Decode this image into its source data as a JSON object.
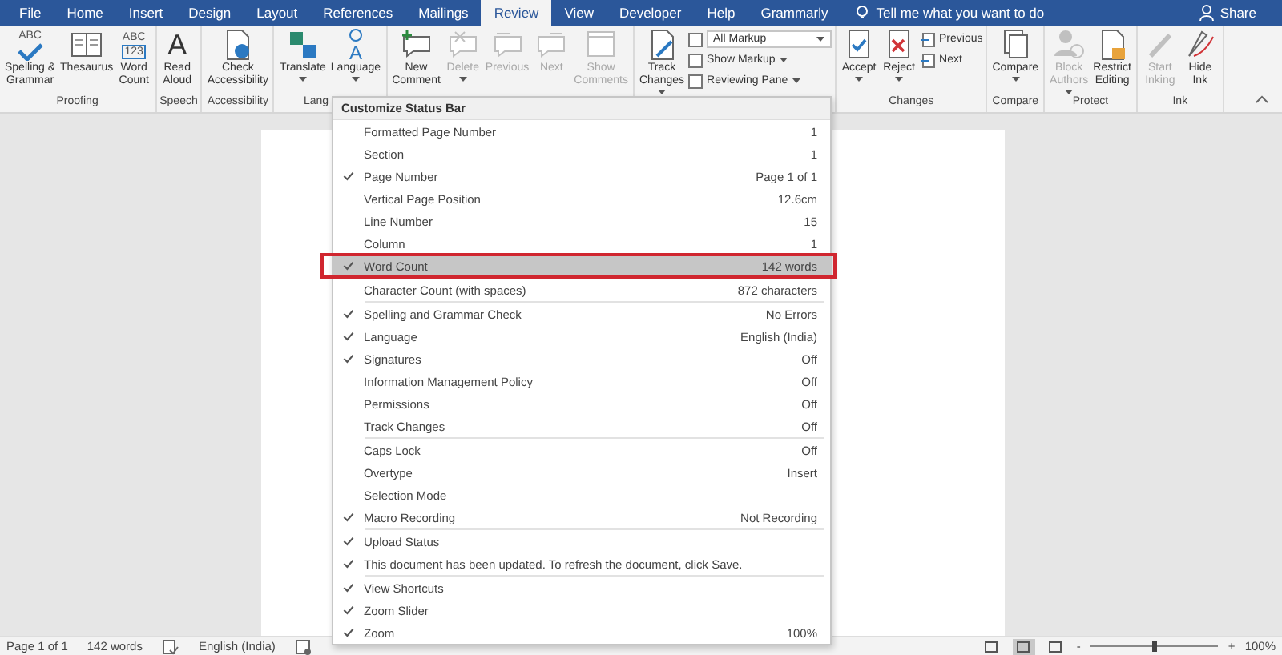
{
  "tabs": [
    {
      "label": "File",
      "selected": false
    },
    {
      "label": "Home",
      "selected": false
    },
    {
      "label": "Insert",
      "selected": false
    },
    {
      "label": "Design",
      "selected": false
    },
    {
      "label": "Layout",
      "selected": false
    },
    {
      "label": "References",
      "selected": false
    },
    {
      "label": "Mailings",
      "selected": false
    },
    {
      "label": "Review",
      "selected": true
    },
    {
      "label": "View",
      "selected": false
    },
    {
      "label": "Developer",
      "selected": false
    },
    {
      "label": "Help",
      "selected": false
    },
    {
      "label": "Grammarly",
      "selected": false
    }
  ],
  "tell_me": {
    "placeholder": "Tell me what you want to do"
  },
  "share": {
    "label": "Share"
  },
  "ribbon": {
    "groups": [
      {
        "label": "Proofing",
        "buttons": [
          {
            "label": "Spelling &\nGrammar",
            "badge": "ABC",
            "disabled": false,
            "dropdown": false
          },
          {
            "label": "Thesaurus",
            "disabled": false,
            "dropdown": false
          },
          {
            "label": "Word\nCount",
            "badge": "ABC",
            "badge_2": "123",
            "disabled": false,
            "dropdown": false
          }
        ]
      },
      {
        "label": "Speech",
        "buttons": [
          {
            "label": "Read\nAloud",
            "badge": "A",
            "disabled": false,
            "dropdown": false
          }
        ]
      },
      {
        "label": "Accessibility",
        "buttons": [
          {
            "label": "Check\nAccessibility",
            "disabled": false,
            "dropdown": false
          }
        ]
      },
      {
        "label": "Lang",
        "buttons": [
          {
            "label": "Translate",
            "disabled": false,
            "dropdown": true
          },
          {
            "label": "Language",
            "badge": "A",
            "disabled": false,
            "dropdown": true
          }
        ]
      },
      {
        "buttons": [
          {
            "label": "New\nComment",
            "disabled": false,
            "dropdown": false
          },
          {
            "label": "Delete",
            "disabled": true,
            "dropdown": true
          },
          {
            "label": "Previous",
            "disabled": true,
            "dropdown": false
          },
          {
            "label": "Next",
            "disabled": true,
            "dropdown": false
          },
          {
            "label": "Show\nComments",
            "disabled": true,
            "dropdown": false
          }
        ]
      },
      {
        "buttons": [
          {
            "label": "Track\nChanges",
            "disabled": false,
            "dropdown": true
          }
        ],
        "small_items": [
          {
            "kind": "select",
            "label": "All Markup"
          },
          {
            "kind": "button",
            "label": "Show Markup",
            "dropdown": true
          },
          {
            "kind": "button",
            "label": "Reviewing Pane",
            "dropdown": true
          }
        ]
      },
      {
        "label": "Changes",
        "buttons": [
          {
            "label": "Accept",
            "disabled": false,
            "dropdown": true
          },
          {
            "label": "Reject",
            "disabled": false,
            "dropdown": true
          }
        ],
        "small_items": [
          {
            "kind": "button",
            "label": "Previous",
            "dropdown": false
          },
          {
            "kind": "button",
            "label": "Next",
            "dropdown": false
          }
        ]
      },
      {
        "label": "Compare",
        "buttons": [
          {
            "label": "Compare",
            "disabled": false,
            "dropdown": true
          }
        ]
      },
      {
        "label": "Protect",
        "buttons": [
          {
            "label": "Block\nAuthors",
            "disabled": true,
            "dropdown": true
          },
          {
            "label": "Restrict\nEditing",
            "disabled": false,
            "dropdown": false
          }
        ]
      },
      {
        "label": "Ink",
        "buttons": [
          {
            "label": "Start\nInking",
            "disabled": true,
            "dropdown": false
          },
          {
            "label": "Hide\nInk",
            "disabled": false,
            "dropdown": false
          }
        ]
      }
    ]
  },
  "menu": {
    "title": "Customize Status Bar",
    "sections": [
      [
        {
          "label": "Formatted Page Number",
          "value": "1",
          "checked": false,
          "highlighted": false,
          "outlined": false
        },
        {
          "label": "Section",
          "value": "1",
          "checked": false,
          "highlighted": false,
          "outlined": false
        },
        {
          "label": "Page Number",
          "value": "Page 1 of 1",
          "checked": true,
          "highlighted": false,
          "outlined": false
        },
        {
          "label": "Vertical Page Position",
          "value": "12.6cm",
          "checked": false,
          "highlighted": false,
          "outlined": false
        },
        {
          "label": "Line Number",
          "value": "15",
          "checked": false,
          "highlighted": false,
          "outlined": false
        },
        {
          "label": "Column",
          "value": "1",
          "checked": false,
          "highlighted": false,
          "outlined": false
        },
        {
          "label": "Word Count",
          "value": "142 words",
          "checked": true,
          "highlighted": true,
          "outlined": true
        }
      ],
      [
        {
          "label": "Character Count (with spaces)",
          "value": "872 characters",
          "checked": false,
          "highlighted": false,
          "outlined": false
        }
      ],
      [
        {
          "label": "Spelling and Grammar Check",
          "value": "No Errors",
          "checked": true,
          "highlighted": false,
          "outlined": false
        },
        {
          "label": "Language",
          "value": "English (India)",
          "checked": true,
          "highlighted": false,
          "outlined": false
        },
        {
          "label": "Signatures",
          "value": "Off",
          "checked": true,
          "highlighted": false,
          "outlined": false
        },
        {
          "label": "Information Management Policy",
          "value": "Off",
          "checked": false,
          "highlighted": false,
          "outlined": false
        },
        {
          "label": "Permissions",
          "value": "Off",
          "checked": false,
          "highlighted": false,
          "outlined": false
        },
        {
          "label": "Track Changes",
          "value": "Off",
          "checked": false,
          "highlighted": false,
          "outlined": false
        }
      ],
      [
        {
          "label": "Caps Lock",
          "value": "Off",
          "checked": false,
          "highlighted": false,
          "outlined": false
        },
        {
          "label": "Overtype",
          "value": "Insert",
          "checked": false,
          "highlighted": false,
          "outlined": false
        },
        {
          "label": "Selection Mode",
          "checked": false,
          "highlighted": false,
          "outlined": false
        },
        {
          "label": "Macro Recording",
          "value": "Not Recording",
          "checked": true,
          "highlighted": false,
          "outlined": false
        }
      ],
      [
        {
          "label": "Upload Status",
          "checked": true,
          "highlighted": false,
          "outlined": false
        },
        {
          "label": "This document has been updated. To refresh the document, click Save.",
          "checked": true,
          "highlighted": false,
          "outlined": false
        }
      ],
      [
        {
          "label": "View Shortcuts",
          "checked": true,
          "highlighted": false,
          "outlined": false
        },
        {
          "label": "Zoom Slider",
          "checked": true,
          "highlighted": false,
          "outlined": false
        },
        {
          "label": "Zoom",
          "value": "100%",
          "checked": true,
          "highlighted": false,
          "outlined": false
        }
      ]
    ]
  },
  "status_bar": {
    "page": "Page 1 of 1",
    "words": "142 words",
    "language": "English (India)",
    "views": [
      {
        "selected": false
      },
      {
        "selected": true
      },
      {
        "selected": false
      }
    ],
    "zoom_out": "-",
    "zoom_in": "+",
    "zoom": {
      "level": 0.5
    },
    "zoom_value": "100%"
  }
}
